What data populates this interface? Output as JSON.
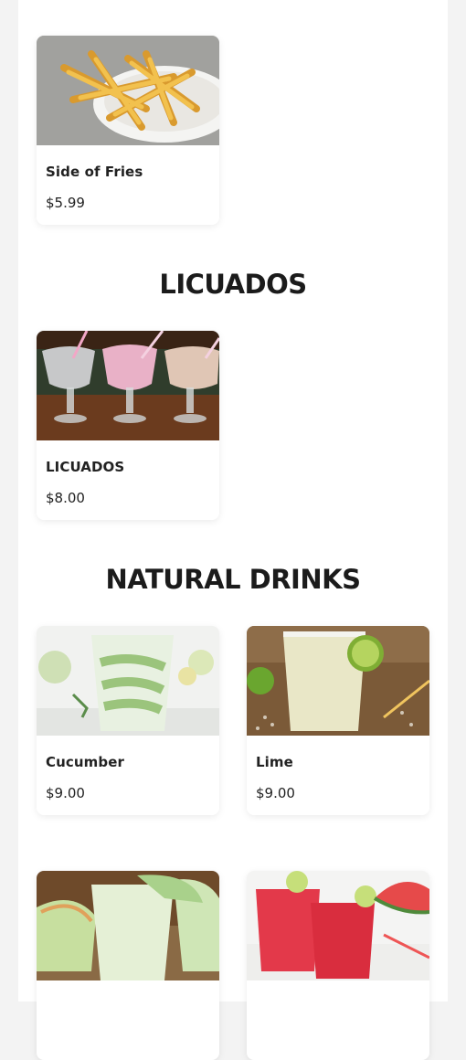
{
  "sections": [
    {
      "title": "",
      "items": [
        {
          "name": "Side of Fries",
          "price": "$5.99",
          "image": "fries-image"
        }
      ]
    },
    {
      "title": "LICUADOS",
      "items": [
        {
          "name": "LICUADOS",
          "price": "$8.00",
          "image": "licuados-image"
        }
      ]
    },
    {
      "title": "NATURAL DRINKS",
      "items": [
        {
          "name": "Cucumber",
          "price": "$9.00",
          "image": "cucumber-drink-image"
        },
        {
          "name": "Lime",
          "price": "$9.00",
          "image": "lime-drink-image"
        },
        {
          "name": "",
          "price": "",
          "image": "melon-drink-image"
        },
        {
          "name": "",
          "price": "",
          "image": "watermelon-drink-image"
        }
      ]
    }
  ],
  "colors": {
    "background": "#f3f3f3",
    "panel": "#ffffff",
    "text": "#222222"
  }
}
